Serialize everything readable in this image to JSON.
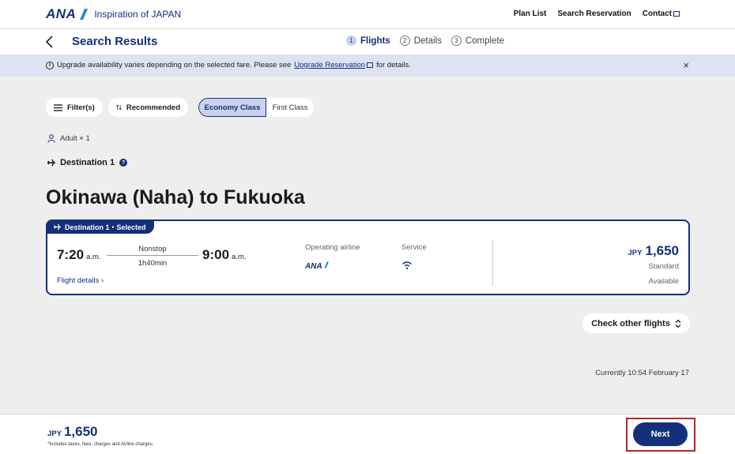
{
  "header": {
    "logo": "ANA",
    "tagline": "Inspiration of JAPAN",
    "nav": [
      "Plan List",
      "Search Reservation",
      "Contact"
    ]
  },
  "subheader": {
    "title": "Search Results",
    "steps": [
      {
        "num": "1",
        "label": "Flights"
      },
      {
        "num": "2",
        "label": "Details"
      },
      {
        "num": "3",
        "label": "Complete"
      }
    ]
  },
  "notice": {
    "text_before": "Upgrade availability varies depending on the selected fare. Please see",
    "link": "Upgrade Reservation",
    "text_after": "for details.",
    "close": "×"
  },
  "filters": {
    "filter_label": "Filter(s)",
    "sort_label": "Recommended",
    "class_options": [
      "Economy Class",
      "First Class"
    ]
  },
  "passengers": "Adult × 1",
  "destination_label": "Destination 1",
  "route_title": "Okinawa (Naha) to Fukuoka",
  "flight": {
    "badge": "Destination 1・Selected",
    "dep_time": "7:20",
    "dep_ampm": "a.m.",
    "arr_time": "9:00",
    "arr_ampm": "a.m.",
    "stops": "Nonstop",
    "duration": "1h40min",
    "details_link": "Flight details",
    "operating_label": "Operating airline",
    "operating_airline": "ANA",
    "service_label": "Service",
    "currency": "JPY",
    "price": "1,650",
    "fare_type": "Standard",
    "availability": "Available"
  },
  "check_other": "Check other flights",
  "currently": "Currently 10:54 February 17",
  "footer": {
    "currency": "JPY",
    "total": "1,650",
    "note": "*Includes taxes, fees, charges and Airline charges.",
    "next_label": "Next"
  },
  "colors": {
    "brand": "#13307a",
    "highlight": "#b8252a",
    "notice_bg": "#dde3f2"
  }
}
